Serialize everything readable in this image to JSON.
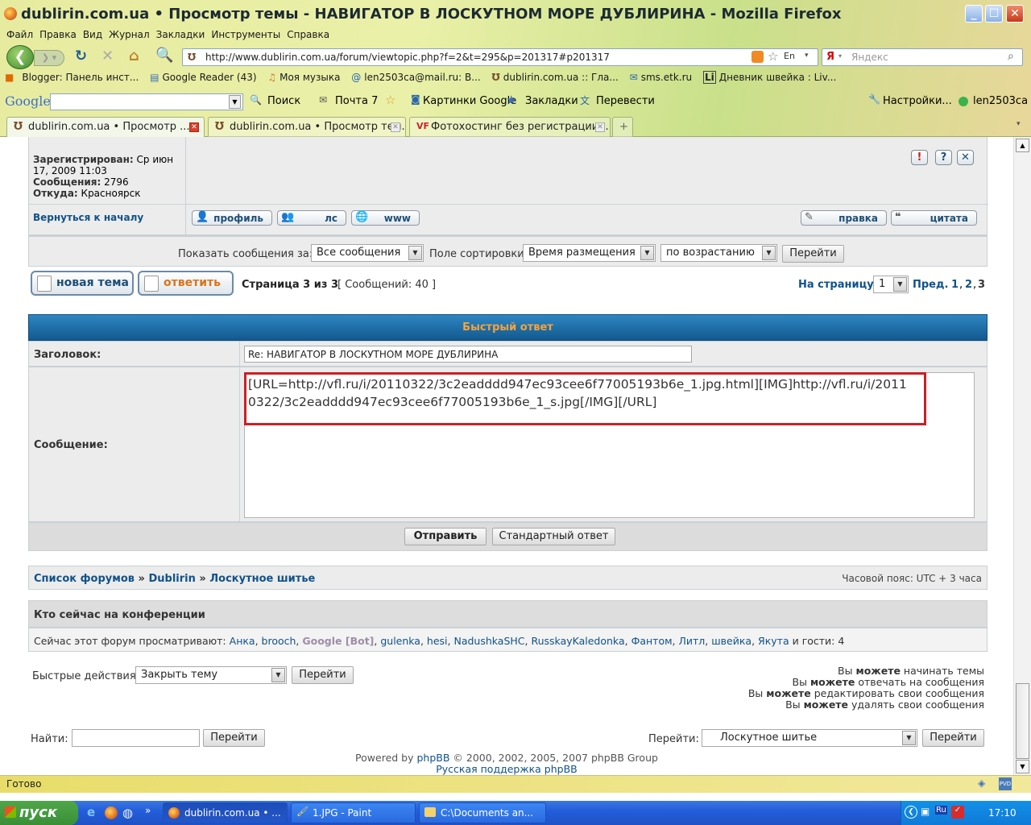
{
  "window": {
    "title": "dublirin.com.ua • Просмотр темы - НАВИГАТОР В ЛОСКУТНОМ МОРЕ ДУБЛИРИНА - Mozilla Firefox"
  },
  "menu": [
    "Файл",
    "Правка",
    "Вид",
    "Журнал",
    "Закладки",
    "Инструменты",
    "Справка"
  ],
  "address": {
    "url": "http://www.dublirin.com.ua/forum/viewtopic.php?f=2&t=295&p=201317#p201317",
    "search_placeholder": "Яндекс"
  },
  "bookmarks": [
    "Blogger: Панель инст...",
    "Google Reader (43)",
    "Моя музыка",
    "len2503ca@mail.ru: В...",
    "dublirin.com.ua :: Гла...",
    "sms.etk.ru",
    "Дневник швейка : Liv..."
  ],
  "google_toolbar": {
    "logo": "Google",
    "items": [
      "Поиск",
      "Почта 7",
      "Картинки Google",
      "Закладки",
      "Перевести"
    ],
    "settings": "Настройки...",
    "user": "len2503ca"
  },
  "tabs": [
    "dublirin.com.ua • Просмотр ...",
    "dublirin.com.ua • Просмотр тем...",
    "Фотохостинг без регистрации. ..."
  ],
  "post": {
    "registered_label": "Зарегистрирован:",
    "registered_value1": "Ср июн",
    "registered_value2": "17, 2009 11:03",
    "posts_label": "Сообщения:",
    "posts_value": "2796",
    "from_label": "Откуда:",
    "from_value": "Красноярск",
    "back_to_top": "Вернуться к началу",
    "buttons": {
      "profile": "профиль",
      "pm": "лс",
      "www": "www",
      "edit": "правка",
      "quote": "цитата"
    },
    "icons": {
      "report": "!",
      "info": "?",
      "delete": "✕"
    }
  },
  "sortbar": {
    "show_label": "Показать сообщения за:",
    "show_value": "Все сообщения",
    "sort_label": "Поле сортировки",
    "sort_value": "Время размещения",
    "order_value": "по возрастанию",
    "go": "Перейти"
  },
  "pagination": {
    "new_topic": "новая тема",
    "reply": "ответить",
    "page_info": "Страница 3 из 3",
    "count_info": "[ Сообщений: 40 ]",
    "on_page": "На страницу",
    "page_select": "1",
    "prev": "Пред.",
    "p1": "1",
    "p2": "2",
    "p3": "3"
  },
  "quick_reply": {
    "title": "Быстрый ответ",
    "subject_label": "Заголовок:",
    "subject_value": "Re: НАВИГАТОР В ЛОСКУТНОМ МОРЕ ДУБЛИРИНА",
    "message_label": "Сообщение:",
    "message_value": "[URL=http://vfl.ru/i/20110322/3c2eadddd947ec93cee6f77005193b6e_1.jpg.html][IMG]http://vfl.ru/i/20110322/3c2eadddd947ec93cee6f77005193b6e_1_s.jpg[/IMG][/URL]",
    "submit": "Отправить",
    "full_editor": "Стандартный ответ"
  },
  "breadcrumb": {
    "index": "Список форумов",
    "forum": "Dublirin",
    "subforum": "Лоскутное шитье",
    "sep": "»",
    "timezone": "Часовой пояс: UTC + 3 часа"
  },
  "online": {
    "title": "Кто сейчас на конференции",
    "prefix": "Сейчас этот форум просматривают:",
    "users": [
      "Анка",
      "brooch",
      "Google [Bot]",
      "gulenka",
      "hesi",
      "NadushkaSHC",
      "RusskayKaledonka",
      "Фантом",
      "Литл",
      "швейка",
      "Якута"
    ],
    "suffix": "и гости: 4"
  },
  "quick_mod": {
    "label": "Быстрые действия:",
    "value": "Закрыть тему",
    "go": "Перейти"
  },
  "permissions": [
    "начинать темы",
    "отвечать на сообщения",
    "редактировать свои сообщения",
    "удалять свои сообщения"
  ],
  "perm_prefix": "Вы",
  "perm_can": "можете",
  "search": {
    "label": "Найти:",
    "go": "Перейти"
  },
  "jump": {
    "label": "Перейти:",
    "value": "Лоскутное шитье",
    "go": "Перейти"
  },
  "footer": {
    "powered": "Powered by",
    "phpbb": "phpBB",
    "copyright": "© 2000, 2002, 2005, 2007 phpBB Group",
    "support": "Русская поддержка phpBB"
  },
  "status": {
    "text": "Готово"
  },
  "taskbar": {
    "start": "пуск",
    "items": [
      "dublirin.com.ua • ...",
      "1.JPG - Paint",
      "C:\\Documents an..."
    ],
    "lang": "RU",
    "clock": "17:10"
  },
  "colors": {
    "accent": "#105289",
    "header_blue": "#1b6ea8",
    "header_text": "#f6a33c",
    "highlight_border": "#cc1f26",
    "panel": "#ececec"
  }
}
